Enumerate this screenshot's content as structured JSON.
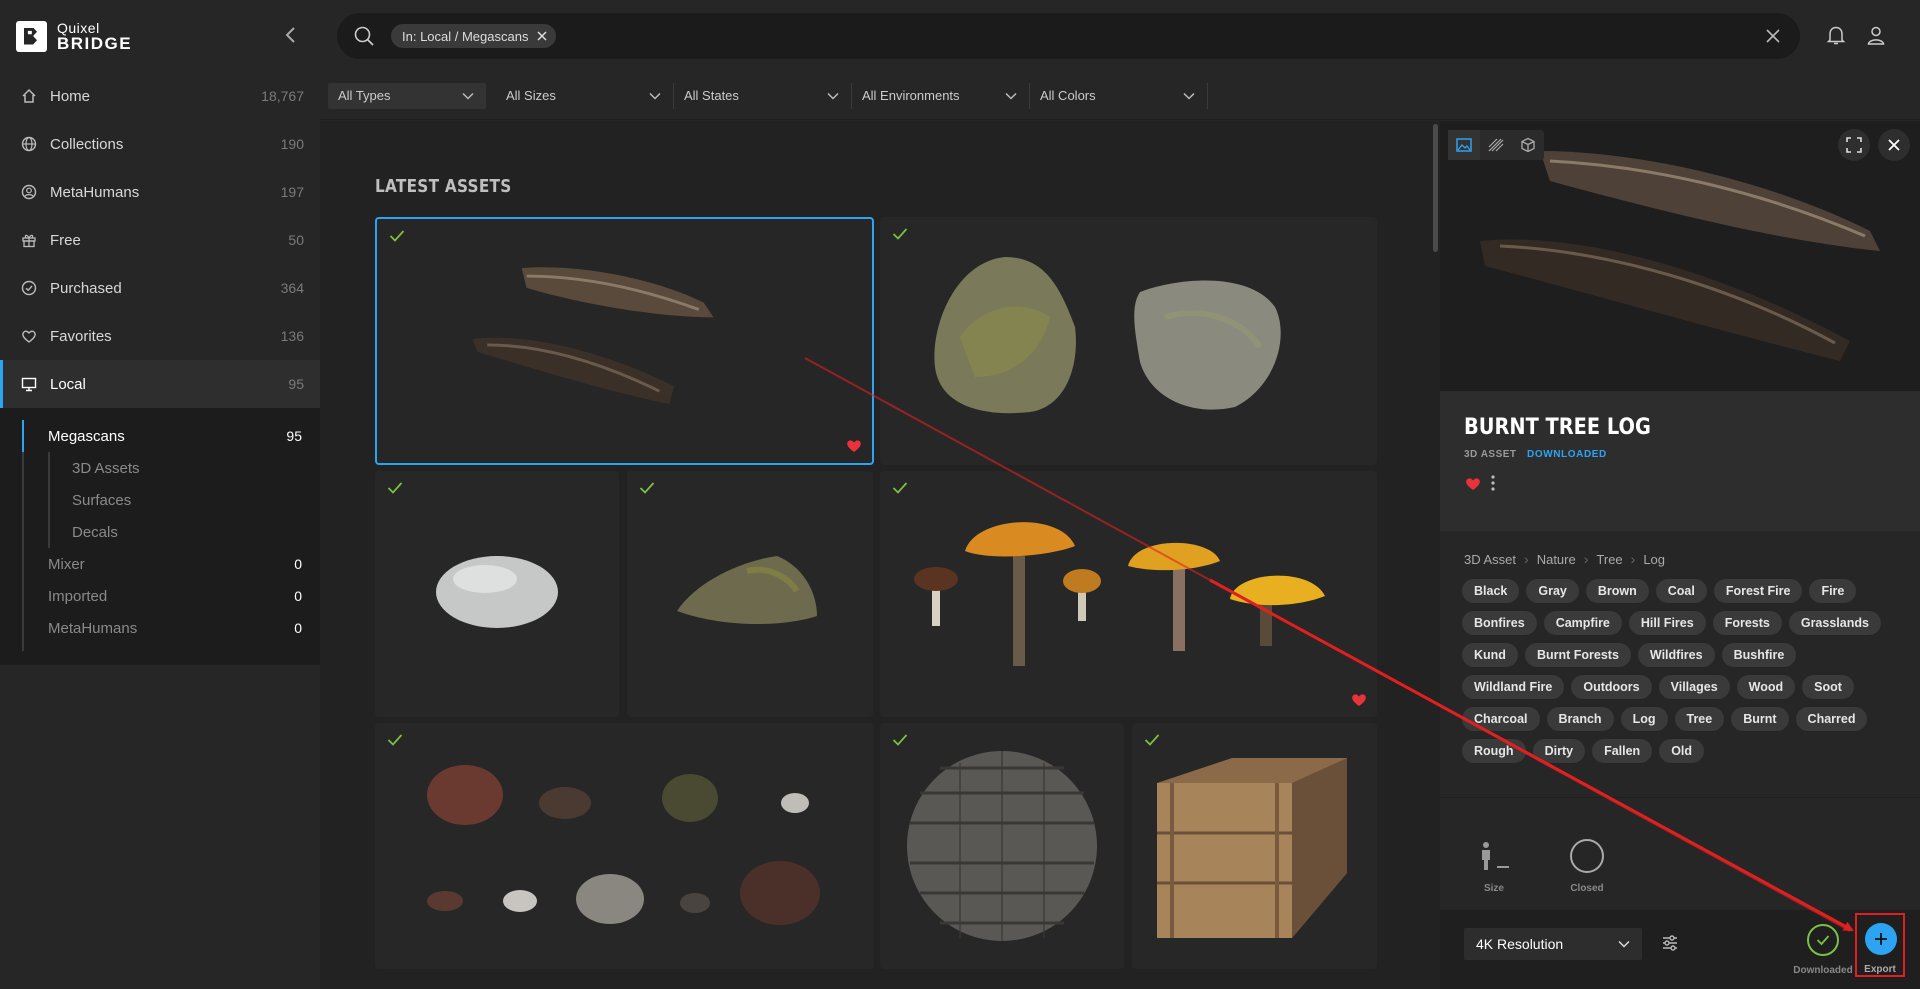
{
  "brand": {
    "line1": "Quixel",
    "line2": "BRIDGE"
  },
  "sidebar": {
    "items": [
      {
        "label": "Home",
        "count": "18,767",
        "icon": "home-icon"
      },
      {
        "label": "Collections",
        "count": "190",
        "icon": "globe-icon"
      },
      {
        "label": "MetaHumans",
        "count": "197",
        "icon": "user-circle-icon"
      },
      {
        "label": "Free",
        "count": "50",
        "icon": "gift-icon"
      },
      {
        "label": "Purchased",
        "count": "364",
        "icon": "check-circle-icon"
      },
      {
        "label": "Favorites",
        "count": "136",
        "icon": "heart-icon"
      },
      {
        "label": "Local",
        "count": "95",
        "icon": "monitor-icon"
      }
    ],
    "sub": {
      "megascans": {
        "label": "Megascans",
        "count": "95"
      },
      "assets3d": "3D Assets",
      "surfaces": "Surfaces",
      "decals": "Decals",
      "mixer": {
        "label": "Mixer",
        "count": "0"
      },
      "imported": {
        "label": "Imported",
        "count": "0"
      },
      "metahumans": {
        "label": "MetaHumans",
        "count": "0"
      }
    }
  },
  "search": {
    "chip": "In: Local / Megascans",
    "value": ""
  },
  "filters": [
    "All Types",
    "All Sizes",
    "All States",
    "All Environments",
    "All Colors"
  ],
  "main": {
    "section_title": "LATEST ASSETS"
  },
  "detail": {
    "title": "BURNT TREE LOG",
    "type": "3D ASSET",
    "status": "DOWNLOADED",
    "breadcrumb": [
      "3D Asset",
      "Nature",
      "Tree",
      "Log"
    ],
    "tags": [
      "Black",
      "Gray",
      "Brown",
      "Coal",
      "Forest Fire",
      "Fire",
      "Bonfires",
      "Campfire",
      "Hill Fires",
      "Forests",
      "Grasslands",
      "Kund",
      "Burnt Forests",
      "Wildfires",
      "Bushfire",
      "Wildland Fire",
      "Outdoors",
      "Villages",
      "Wood",
      "Soot",
      "Charcoal",
      "Branch",
      "Log",
      "Tree",
      "Burnt",
      "Charred",
      "Rough",
      "Dirty",
      "Fallen",
      "Old"
    ],
    "meta": {
      "size_label": "Size",
      "closed_label": "Closed"
    },
    "resolution": "4K Resolution",
    "downloaded_label": "Downloaded",
    "export_label": "Export"
  },
  "colors": {
    "accent": "#2ea3f2",
    "check": "#7bc043",
    "heart": "#e8333a",
    "annotation": "#e02020"
  }
}
